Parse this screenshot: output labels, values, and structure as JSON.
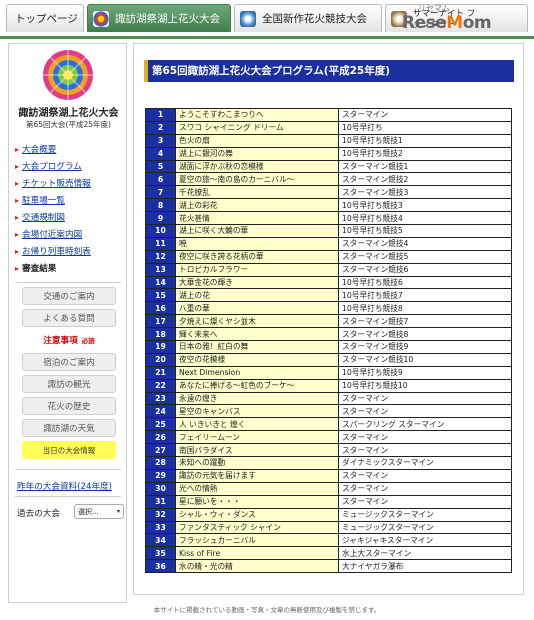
{
  "nav": {
    "tabs": [
      {
        "label": "トップページ"
      },
      {
        "label": "諏訪湖祭湖上花火大会"
      },
      {
        "label": "全国新作花火競技大会"
      },
      {
        "label": "サマーナイト ファンタジー"
      }
    ],
    "brand": "ReseMom",
    "brand_sub": "リセマム"
  },
  "sidebar": {
    "title": "諏訪湖祭湖上花火大会",
    "subtitle": "第65回大会(平成25年度)",
    "menu": [
      "大会概要",
      "大会プログラム",
      "チケット販売情報",
      "駐車場一覧",
      "交通規制図",
      "会場付近案内図",
      "お帰り列車時刻表",
      "審査結果"
    ],
    "buttons": [
      "交通のご案内",
      "よくある質問",
      "注意事項",
      "宿泊のご案内",
      "諏訪の観光",
      "花火の歴史",
      "諏訪湖の天気"
    ],
    "must_label": "必読",
    "today_info": "当日の大会情報",
    "past_docs": "昨年の大会資料(24年度)",
    "past_label": "過去の大会",
    "select_value": "選択..."
  },
  "main": {
    "heading": "第65回諏訪湖上花火大会プログラム(平成25年度)",
    "rows": [
      {
        "no": "1",
        "name": "ようこそすわこまつりへ",
        "type": "スターマイン"
      },
      {
        "no": "2",
        "name": "スワコ シャイニング ドリーム",
        "type": "10号早打ち"
      },
      {
        "no": "3",
        "name": "色火の扇",
        "type": "10号早打ち競技1"
      },
      {
        "no": "4",
        "name": "湖上に銀河の舞",
        "type": "10号早打ち競技2"
      },
      {
        "no": "5",
        "name": "湖面に浮かぶ秋の恋模様",
        "type": "スターマイン競技1"
      },
      {
        "no": "6",
        "name": "夏空の旅～南の島のカーニバル～",
        "type": "スターマイン競技2"
      },
      {
        "no": "7",
        "name": "千花繚乱",
        "type": "スターマイン競技3"
      },
      {
        "no": "8",
        "name": "湖上の彩花",
        "type": "10号早打ち競技3"
      },
      {
        "no": "9",
        "name": "花火甚情",
        "type": "10号早打ち競技4"
      },
      {
        "no": "10",
        "name": "湖上に咲く大輪の華",
        "type": "10号早打ち競技5"
      },
      {
        "no": "11",
        "name": "暁",
        "type": "スターマイン競技4"
      },
      {
        "no": "12",
        "name": "夜空に咲き誇る花柄の華",
        "type": "スターマイン競技5"
      },
      {
        "no": "13",
        "name": "トロピカルフラワー",
        "type": "スターマイン競技6"
      },
      {
        "no": "14",
        "name": "大華金花の輝き",
        "type": "10号早打ち競技6"
      },
      {
        "no": "15",
        "name": "湖上の花",
        "type": "10号早打ち競技7"
      },
      {
        "no": "16",
        "name": "八重の華",
        "type": "10号早打ち競技8"
      },
      {
        "no": "17",
        "name": "夕焼えに燦くヤシ並木",
        "type": "スターマイン競技7"
      },
      {
        "no": "18",
        "name": "輝く未来へ",
        "type": "スターマイン競技8"
      },
      {
        "no": "19",
        "name": "日本の雅！紅白の舞",
        "type": "スターマイン競技9"
      },
      {
        "no": "20",
        "name": "夜空の花模様",
        "type": "スターマイン競技10"
      },
      {
        "no": "21",
        "name": "Next Dimension",
        "type": "10号早打ち競技9"
      },
      {
        "no": "22",
        "name": "あなたに捧げる～虹色のブーケ～",
        "type": "10号早打ち競技10"
      },
      {
        "no": "23",
        "name": "永遠の煌き",
        "type": "スターマイン"
      },
      {
        "no": "24",
        "name": "星空のキャンバス",
        "type": "スターマイン"
      },
      {
        "no": "25",
        "name": "人 いきいきと 煌く",
        "type": "スパークリング スターマイン"
      },
      {
        "no": "26",
        "name": "フェイリームーン",
        "type": "スターマイン"
      },
      {
        "no": "27",
        "name": "南国パラダイス",
        "type": "スターマイン"
      },
      {
        "no": "28",
        "name": "未知への躍動",
        "type": "ダイナミックスターマイン"
      },
      {
        "no": "29",
        "name": "諏訪の元気を届けます",
        "type": "スターマイン"
      },
      {
        "no": "30",
        "name": "光への情熱",
        "type": "スターマイン"
      },
      {
        "no": "31",
        "name": "星に願いを・・・",
        "type": "スターマイン"
      },
      {
        "no": "32",
        "name": "シャル・ウィ・ダンス",
        "type": "ミュージックスターマイン"
      },
      {
        "no": "33",
        "name": "ファンタスティック シャイン",
        "type": "ミュージックスターマイン"
      },
      {
        "no": "34",
        "name": "フラッシュカーニバル",
        "type": "ジャキジャキスターマイン"
      },
      {
        "no": "35",
        "name": "Kiss of Fire",
        "type": "水上大スターマイン"
      },
      {
        "no": "36",
        "name": "水の精・光の精",
        "type": "大ナイヤガラ瀑布"
      }
    ]
  },
  "footer": "本サイトに掲載されている動画・写真・文章の無断使用及び複製を禁じます。",
  "colors": {
    "nav_green": "#4a8f55",
    "heading_blue": "#1a2fa0",
    "cell_yellow": "#ffffcc",
    "link_blue": "#0b3aa0"
  }
}
